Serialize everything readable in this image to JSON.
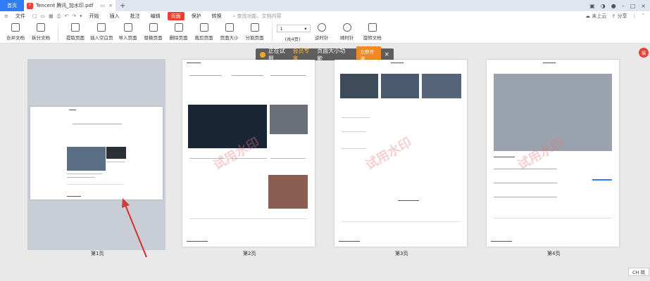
{
  "tabs": {
    "home": "首页",
    "doc": "Tencent 腾讯_加水印.pdf"
  },
  "menu": {
    "file": "文件",
    "items": [
      "开始",
      "插入",
      "批注",
      "编辑",
      "页面",
      "保护",
      "转换"
    ],
    "active_index": 4,
    "search_placeholder": "查找功能、文档内容",
    "cloud": "未上云",
    "share": "分享"
  },
  "toolbar": {
    "merge": "合并文档",
    "split": "拆分文档",
    "extract": "提取页面",
    "insert_blank": "插入空白页",
    "import": "导入页面",
    "replace": "替换页面",
    "delete": "删除页面",
    "crop": "裁剪页面",
    "page_size": "页面大小",
    "split_page": "分割页面",
    "page_value": "1",
    "page_total": "(共4页)",
    "rotate_left": "逆时针",
    "rotate_right": "顺时针",
    "rotate_doc": "旋转文档"
  },
  "promo": {
    "prefix": "正在试用",
    "highlight": "会员专享",
    "suffix": "页面大小功能",
    "button": "立即开通"
  },
  "pages": [
    {
      "label": "第1页"
    },
    {
      "label": "第2页"
    },
    {
      "label": "第3页"
    },
    {
      "label": "第4页"
    }
  ],
  "watermark": "试用水印",
  "badge": "福",
  "ime": "CH 简",
  "colors": {
    "accent": "#2f7cf6",
    "active_tab": "#e94235",
    "promo_btn": "#f08a24"
  }
}
